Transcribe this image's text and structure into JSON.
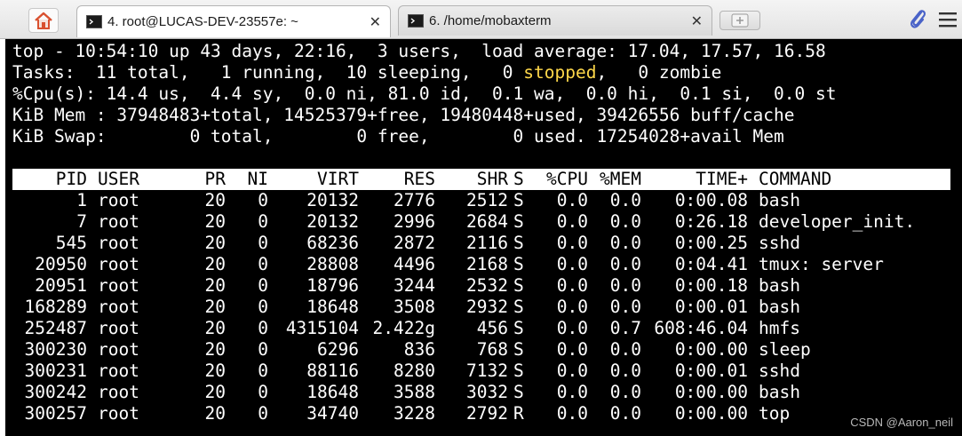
{
  "tabs": [
    {
      "label": "4. root@LUCAS-DEV-23557e: ~",
      "active": true,
      "close": "✕"
    },
    {
      "label": "6. /home/mobaxterm",
      "active": false,
      "close": "✕"
    }
  ],
  "icons": {
    "home": "home-icon",
    "new_tab": "new-tab-icon",
    "attach": "paperclip-icon",
    "menu": "hamburger-menu-icon"
  },
  "colors": {
    "terminal_bg": "#000000",
    "terminal_fg": "#ffffff",
    "highlight": "#ffd84a",
    "home_icon": "#d9502f",
    "clip_icon": "#4a63c8"
  },
  "summary": {
    "line1": "top - 10:54:10 up 43 days, 22:16,  3 users,  load average: 17.04, 17.57, 16.58",
    "line2_pre": "Tasks:  11 total,   1 running,  10 sleeping,   0 ",
    "line2_hl": "stopped",
    "line2_post": ",   0 zombie",
    "line3": "%Cpu(s): 14.4 us,  4.4 sy,  0.0 ni, 81.0 id,  0.1 wa,  0.0 hi,  0.1 si,  0.0 st",
    "line4": "KiB Mem : 37948483+total, 14525379+free, 19480448+used, 39426556 buff/cache",
    "line5": "KiB Swap:        0 total,        0 free,        0 used. 17254028+avail Mem"
  },
  "columns": [
    "PID",
    "USER",
    "PR",
    "NI",
    "VIRT",
    "RES",
    "SHR",
    "S",
    "%CPU",
    "%MEM",
    "TIME+",
    "COMMAND"
  ],
  "processes": [
    [
      "1",
      "root",
      "20",
      "0",
      "20132",
      "2776",
      "2512",
      "S",
      "0.0",
      "0.0",
      "0:00.08",
      "bash"
    ],
    [
      "7",
      "root",
      "20",
      "0",
      "20132",
      "2996",
      "2684",
      "S",
      "0.0",
      "0.0",
      "0:26.18",
      "developer_init."
    ],
    [
      "545",
      "root",
      "20",
      "0",
      "68236",
      "2872",
      "2116",
      "S",
      "0.0",
      "0.0",
      "0:00.25",
      "sshd"
    ],
    [
      "20950",
      "root",
      "20",
      "0",
      "28808",
      "4496",
      "2168",
      "S",
      "0.0",
      "0.0",
      "0:04.41",
      "tmux: server"
    ],
    [
      "20951",
      "root",
      "20",
      "0",
      "18796",
      "3244",
      "2532",
      "S",
      "0.0",
      "0.0",
      "0:00.18",
      "bash"
    ],
    [
      "168289",
      "root",
      "20",
      "0",
      "18648",
      "3508",
      "2932",
      "S",
      "0.0",
      "0.0",
      "0:00.01",
      "bash"
    ],
    [
      "252487",
      "root",
      "20",
      "0",
      "4315104",
      "2.422g",
      "456",
      "S",
      "0.0",
      "0.7",
      "608:46.04",
      "hmfs"
    ],
    [
      "300230",
      "root",
      "20",
      "0",
      "6296",
      "836",
      "768",
      "S",
      "0.0",
      "0.0",
      "0:00.00",
      "sleep"
    ],
    [
      "300231",
      "root",
      "20",
      "0",
      "88116",
      "8280",
      "7132",
      "S",
      "0.0",
      "0.0",
      "0:00.01",
      "sshd"
    ],
    [
      "300242",
      "root",
      "20",
      "0",
      "18648",
      "3588",
      "3032",
      "S",
      "0.0",
      "0.0",
      "0:00.00",
      "bash"
    ],
    [
      "300257",
      "root",
      "20",
      "0",
      "34740",
      "3228",
      "2792",
      "R",
      "0.0",
      "0.0",
      "0:00.00",
      "top"
    ]
  ],
  "watermark": "CSDN @Aaron_neil"
}
